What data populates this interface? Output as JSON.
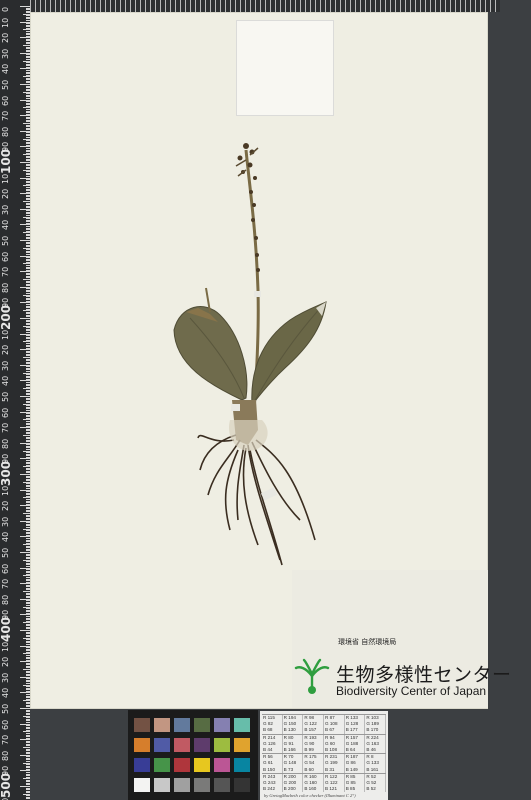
{
  "ruler": {
    "labels": [
      "0",
      "10",
      "20",
      "30",
      "40",
      "50",
      "60",
      "70",
      "80",
      "90",
      "100",
      "10",
      "20",
      "30",
      "40",
      "50",
      "60",
      "70",
      "80",
      "90",
      "200",
      "10",
      "20",
      "30",
      "40",
      "50",
      "60",
      "70",
      "80",
      "90",
      "300",
      "10",
      "20",
      "30",
      "40",
      "50",
      "60",
      "70",
      "80",
      "90",
      "400",
      "10",
      "20",
      "30",
      "40",
      "50",
      "60",
      "70",
      "80",
      "90",
      "500",
      "10"
    ]
  },
  "label": {
    "agency": "環境省 自然環境局",
    "center_jp": "生物多様性センター",
    "center_en": "Biodiversity Center of Japan"
  },
  "colors": {
    "sheet": "#efeee3",
    "leaf": "#6f6b4c",
    "stem": "#7a6b45",
    "root": "#3a2d20",
    "logo_green": "#2f9e3f"
  },
  "color_checker": {
    "patches": [
      "#735244",
      "#c29682",
      "#627a9d",
      "#576c43",
      "#8580b1",
      "#67bdaa",
      "#d67e2c",
      "#505ba6",
      "#c15a63",
      "#5e3c6c",
      "#9dbc40",
      "#e0a32e",
      "#383d96",
      "#469449",
      "#af363c",
      "#e7c71f",
      "#bb5695",
      "#0885a1",
      "#f3f3f2",
      "#c8c8c8",
      "#a0a0a0",
      "#7a7a79",
      "#555555",
      "#343434"
    ]
  },
  "gray_card": {
    "rows": [
      [
        "R 115",
        "R 194",
        "R 98",
        "R 87",
        "R 133",
        "R 103"
      ],
      [
        "G 82",
        "G 150",
        "G 122",
        "G 108",
        "G 128",
        "G 189"
      ],
      [
        "B 68",
        "B 130",
        "B 157",
        "B 67",
        "B 177",
        "B 170"
      ],
      [
        "R 214",
        "R 80",
        "R 193",
        "R 94",
        "R 157",
        "R 224"
      ],
      [
        "G 126",
        "G 91",
        "G 90",
        "G 60",
        "G 188",
        "G 163"
      ],
      [
        "B 44",
        "B 166",
        "B 99",
        "B 108",
        "B 64",
        "B 46"
      ],
      [
        "R 56",
        "R 70",
        "R 175",
        "R 231",
        "R 187",
        "R 8"
      ],
      [
        "G 61",
        "G 148",
        "G 54",
        "G 199",
        "G 86",
        "G 133"
      ],
      [
        "B 150",
        "B 73",
        "B 60",
        "B 31",
        "B 149",
        "B 161"
      ],
      [
        "R 243",
        "R 200",
        "R 160",
        "R 122",
        "R 85",
        "R 52"
      ],
      [
        "G 243",
        "G 200",
        "G 160",
        "G 122",
        "G 85",
        "G 52"
      ],
      [
        "B 242",
        "B 200",
        "B 160",
        "B 121",
        "B 85",
        "B 52"
      ]
    ],
    "footer": "by GretagMacbeth color checker (Illuminant C 2°)"
  }
}
